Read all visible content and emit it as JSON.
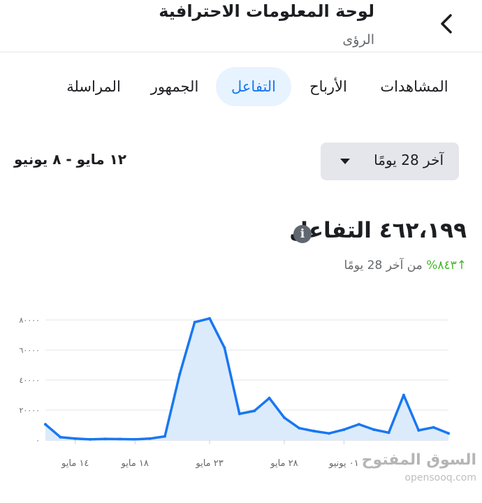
{
  "header": {
    "title": "لوحة المعلومات الاحترافية",
    "subtitle": "الرؤى",
    "back_icon": "chevron-left-icon"
  },
  "tabs": [
    {
      "label": "المشاهدات",
      "active": false
    },
    {
      "label": "الأرباح",
      "active": false
    },
    {
      "label": "التفاعل",
      "active": true
    },
    {
      "label": "الجمهور",
      "active": false
    },
    {
      "label": "المراسلة",
      "active": false
    }
  ],
  "date_range": "١٢ مايو - ٨ يونيو",
  "period_select": {
    "value": "آخر 28 يومًا",
    "icon": "caret-down-icon"
  },
  "metric": {
    "value_text": "٤٦٢،١٩٩ التفاعل",
    "info_icon": "info-icon",
    "change_arrow": "↑",
    "change_percent": "٨٤٣%",
    "change_text": "من آخر 28 يومًا"
  },
  "colors": {
    "accent": "#1877f2",
    "tab_active_bg": "#e7f3ff",
    "positive": "#42b72a",
    "chart_fill": "#dcebfb"
  },
  "watermark": {
    "title": "السوق المفتوح",
    "subtitle": "opensooq.com"
  },
  "chart_data": {
    "type": "area",
    "x": [
      "١٢ مايو",
      "١٣ مايو",
      "١٤ مايو",
      "١٥ مايو",
      "١٦ مايو",
      "١٧ مايو",
      "١٨ مايو",
      "١٩ مايو",
      "٢٠ مايو",
      "٢١ مايو",
      "٢٢ مايو",
      "٢٣ مايو",
      "٢٤ مايو",
      "٢٥ مايو",
      "٢٦ مايو",
      "٢٧ مايو",
      "٢٨ مايو",
      "٢٩ مايو",
      "٣٠ مايو",
      "٣١ مايو",
      "٠١ يونيو",
      "٠٢ يونيو",
      "٠٣ يونيو",
      "٠٤ يونيو",
      "٠٥ يونيو",
      "٠٦ يونيو",
      "٠٧ يونيو",
      "٠٨ يونيو"
    ],
    "values": [
      10500,
      2000,
      1000,
      500,
      800,
      700,
      500,
      1000,
      2500,
      44000,
      78500,
      81000,
      61500,
      17500,
      19500,
      28000,
      15000,
      8000,
      6000,
      4500,
      7000,
      10500,
      7000,
      5000,
      30000,
      6500,
      8500,
      4500
    ],
    "y_ticks": [
      "٠",
      "٢٠٠٠٠",
      "٤٠٠٠٠",
      "٦٠٠٠٠",
      "٨٠٠٠٠"
    ],
    "y_tick_values": [
      0,
      20000,
      40000,
      60000,
      80000
    ],
    "x_ticks": [
      "١٤ مايو",
      "١٨ مايو",
      "٢٣ مايو",
      "٢٨ مايو",
      "٠١ يونيو"
    ],
    "x_tick_index": [
      2,
      6,
      11,
      16,
      20
    ],
    "ylim": [
      0,
      80000
    ],
    "grid": true
  }
}
